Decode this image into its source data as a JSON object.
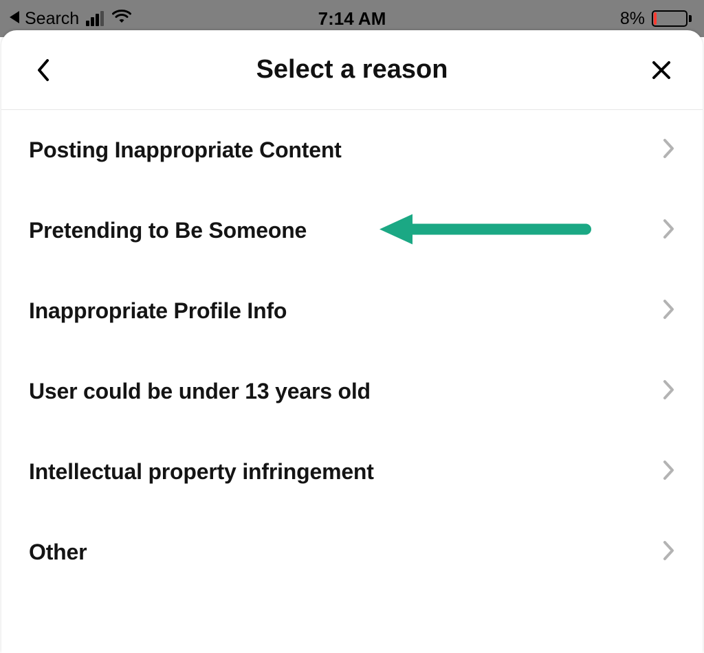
{
  "status_bar": {
    "back_label": "Search",
    "time": "7:14 AM",
    "battery_percent": "8%"
  },
  "header": {
    "title": "Select a reason"
  },
  "reasons": [
    {
      "label": "Posting Inappropriate Content"
    },
    {
      "label": "Pretending to Be Someone"
    },
    {
      "label": "Inappropriate Profile Info"
    },
    {
      "label": "User could be under 13 years old"
    },
    {
      "label": "Intellectual property infringement"
    },
    {
      "label": "Other"
    }
  ],
  "annotation": {
    "highlight_index": 1,
    "color": "#1ba884"
  }
}
